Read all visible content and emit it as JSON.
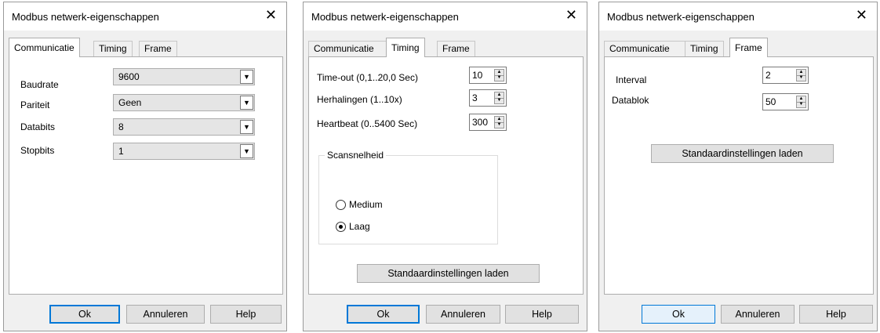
{
  "dialogs": [
    {
      "title": "Modbus netwerk-eigenschappen",
      "tabs": [
        "Communicatie",
        "Timing",
        "Frame"
      ],
      "active_tab": "Communicatie",
      "fields": [
        {
          "label": "Baudrate",
          "value": "9600"
        },
        {
          "label": "Pariteit",
          "value": "Geen"
        },
        {
          "label": "Databits",
          "value": "8"
        },
        {
          "label": "Stopbits",
          "value": "1"
        }
      ],
      "buttons": {
        "ok": "Ok",
        "cancel": "Annuleren",
        "help": "Help"
      }
    },
    {
      "title": "Modbus netwerk-eigenschappen",
      "tabs": [
        "Communicatie",
        "Timing",
        "Frame"
      ],
      "active_tab": "Timing",
      "fields": [
        {
          "label": "Time-out (0,1..20,0 Sec)",
          "value": "10"
        },
        {
          "label": "Herhalingen (1..10x)",
          "value": "3"
        },
        {
          "label": "Heartbeat (0..5400 Sec)",
          "value": "300"
        }
      ],
      "scan_group": {
        "label": "Scansnelheid",
        "options": [
          {
            "label": "Medium",
            "checked": false
          },
          {
            "label": "Laag",
            "checked": true
          }
        ]
      },
      "defaults_button": "Standaardinstellingen laden",
      "buttons": {
        "ok": "Ok",
        "cancel": "Annuleren",
        "help": "Help"
      }
    },
    {
      "title": "Modbus netwerk-eigenschappen",
      "tabs": [
        "Communicatie",
        "Timing",
        "Frame"
      ],
      "active_tab": "Frame",
      "fields": [
        {
          "label": "Interval",
          "value": "2"
        },
        {
          "label": "Datablok",
          "value": "50"
        }
      ],
      "defaults_button": "Standaardinstellingen laden",
      "buttons": {
        "ok": "Ok",
        "cancel": "Annuleren",
        "help": "Help"
      }
    }
  ],
  "icons": {
    "close": "close-icon",
    "combo_arrow": "chevron-down-icon",
    "spin": "spinner-arrows-icon"
  },
  "colors": {
    "dialog_bg": "#f0f0f0",
    "panel_bg": "#ffffff",
    "accent": "#0078d7"
  }
}
